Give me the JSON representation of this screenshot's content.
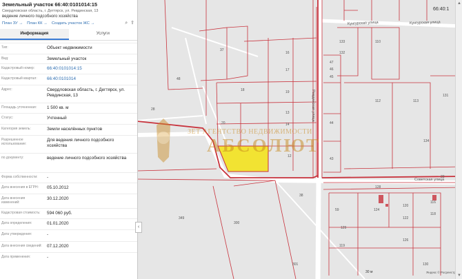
{
  "header": {
    "title": "Земельный участок 66:40:0101014:15",
    "address": "Свердловская область, г. Дегтярск, ул. Ревдинская, 13",
    "purpose": "ведение личного подсобного хозяйства"
  },
  "links": {
    "plan_zu": "План ЗУ →",
    "plan_kk": "План КК →",
    "create_zhs": "Создать участок ЖС →"
  },
  "tabs": {
    "info": "Информация",
    "services": "Услуги"
  },
  "rows": [
    {
      "label": "Тип:",
      "value": "Объект недвижимости"
    },
    {
      "label": "Вид:",
      "value": "Земельный участок"
    },
    {
      "label": "Кадастровый номер:",
      "value": "66:40:0101014:15"
    },
    {
      "label": "Кадастровый квартал:",
      "value": "66:40:0101014"
    },
    {
      "label": "Адрес:",
      "value": "Свердловская область, г. Дегтярск, ул. Ревдинская, 13"
    },
    {
      "label": "Площадь уточненная:",
      "value": "1 500 кв. м"
    },
    {
      "label": "Статус:",
      "value": "Учтенный"
    },
    {
      "label": "Категория земель:",
      "value": "Земли населённых пунктов"
    },
    {
      "label": "Разрешенное использование:",
      "value": "Для ведения личного подсобного хозяйства"
    },
    {
      "label": "по документу:",
      "value": "ведение личного подсобного хозяйства"
    },
    {
      "label": "Форма собственности:",
      "value": "-"
    },
    {
      "label": "Дата внесения в ЕГРН:",
      "value": "05.10.2012"
    },
    {
      "label": "Дата внесения изменений:",
      "value": "30.12.2020"
    },
    {
      "label": "Кадастровая стоимость:",
      "value": "594 060 руб."
    },
    {
      "label": "Дата определения:",
      "value": "01.01.2020"
    },
    {
      "label": "Дата утверждения:",
      "value": "-"
    },
    {
      "label": "Дата внесения сведений:",
      "value": "07.12.2020"
    },
    {
      "label": "Дата применения:",
      "value": "-"
    }
  ],
  "map": {
    "coord_label": "66:40:1",
    "streets": {
      "kungurskaya": "Кунгурская улица",
      "sovetskaya": "Советская улица",
      "revdinskaya": "Ревдинская улица"
    },
    "parcel_numbers": [
      "37",
      "16",
      "17",
      "18",
      "19",
      "20",
      "12",
      "13",
      "14",
      "48",
      "47",
      "46",
      "45",
      "44",
      "43",
      "133",
      "132",
      "110",
      "112",
      "113",
      "131",
      "134",
      "120",
      "122",
      "126",
      "124",
      "128",
      "130",
      "116",
      "118",
      "349",
      "129",
      "300",
      "301",
      "119",
      "28",
      "38",
      "59",
      "23"
    ],
    "watermark_small": "ЗЕТ АГЕНТСТВО НЕДВИЖИМОСТИ",
    "watermark_big": "АБСОЛЮТ",
    "scale": "30 м",
    "attribution": "Яндекс © Росреестр",
    "colors": {
      "parcel_line": "#c8323c",
      "highlight": "#f2e332",
      "bg": "#e6e6e6"
    }
  }
}
